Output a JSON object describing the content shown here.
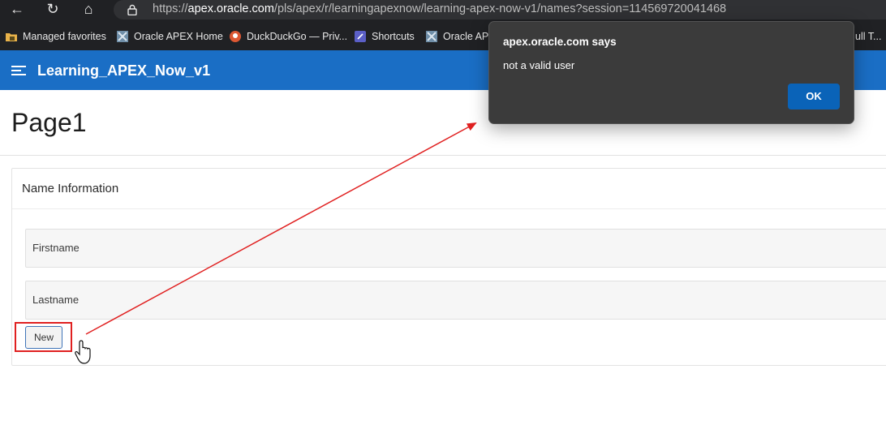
{
  "browser": {
    "url_host": "apex.oracle.com",
    "url_prefix": "https://",
    "url_path": "/pls/apex/r/learningapexnow/learning-apex-now-v1/names?session=114569720041468",
    "favorites": [
      {
        "label": "Managed favorites",
        "icon": "folder-icon"
      },
      {
        "label": "Oracle APEX Home",
        "icon": "apex-icon"
      },
      {
        "label": "DuckDuckGo — Priv...",
        "icon": "duckduckgo-icon"
      },
      {
        "label": "Shortcuts",
        "icon": "shortcuts-icon"
      },
      {
        "label": "Oracle APE",
        "icon": "apex-icon"
      },
      {
        "label": "ull T...",
        "icon": ""
      }
    ]
  },
  "app": {
    "title": "Learning_APEX_Now_v1",
    "page_title": "Page1",
    "region_title": "Name Information",
    "fields": [
      {
        "label": "Firstname"
      },
      {
        "label": "Lastname"
      }
    ],
    "new_button": "New"
  },
  "dialog": {
    "title": "apex.oracle.com says",
    "message": "not a valid user",
    "ok_label": "OK"
  },
  "colors": {
    "header": "#1a6ec5",
    "highlight": "#e02020",
    "dialog_bg": "#3b3b3b",
    "ok_button": "#0a63b8"
  }
}
